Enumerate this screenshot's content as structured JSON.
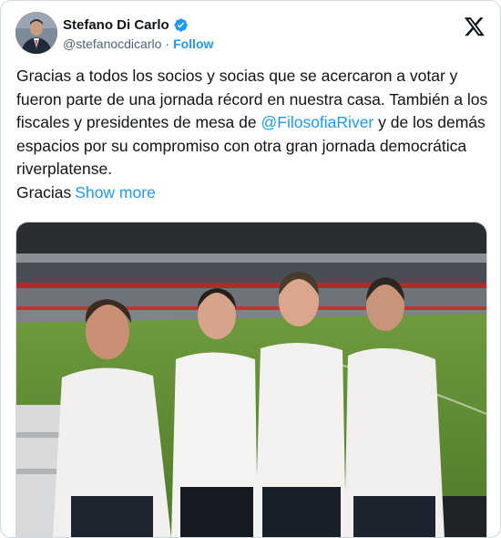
{
  "author": {
    "display_name": "Stefano Di Carlo",
    "handle": "@stefanocdicarlo",
    "separator": "·",
    "follow_label": "Follow",
    "verified": true,
    "verified_color": "#1d9bf0"
  },
  "platform": {
    "logo_icon": "x-logo-icon"
  },
  "tweet": {
    "text_before_mention": "Gracias a todos los socios y socias que se acercaron a votar y fueron parte de una jornada récord en nuestra casa. También a los fiscales y presidentes de mesa de ",
    "mention": "@FilosofiaRiver",
    "text_after_mention": " y de los demás espacios por su compromiso con otra gran jornada democrática riverplatense.",
    "second_paragraph": "Gracias",
    "show_more_label": "Show more"
  },
  "media": {
    "type": "photo",
    "icon": "photo-four-men-stadium"
  },
  "colors": {
    "link": "#1d9bf0",
    "text": "#0f1419",
    "secondary": "#536471",
    "border": "#cfd9de"
  }
}
